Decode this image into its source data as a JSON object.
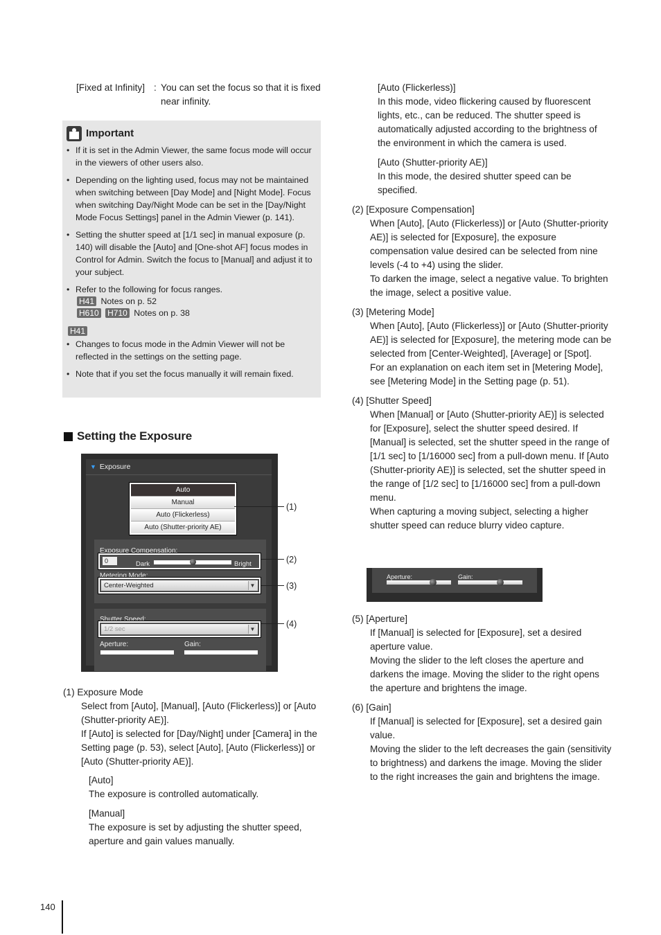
{
  "definition": {
    "term": "[Fixed at Infinity]",
    "colon": ":",
    "desc": "You can set the focus so that it is fixed near infinity."
  },
  "important": {
    "icon": "important-book-icon",
    "title": "Important",
    "items": [
      "If it is set in the Admin Viewer, the same focus mode will occur in the viewers of other users also.",
      "Depending on the lighting used, focus may not be maintained when switching between [Day Mode] and [Night Mode]. Focus when switching Day/Night Mode can be set in the [Day/Night Mode Focus Settings] panel in the Admin Viewer (p. 141).",
      "Setting the shutter speed at [1/1 sec] in manual exposure (p. 140) will disable the [Auto] and [One-shot AF] focus modes in Control for Admin. Switch the focus to [Manual] and adjust it to your subject.",
      "Refer to the following for focus ranges."
    ],
    "ranges": [
      {
        "badges": [
          "H41"
        ],
        "text": "Notes on p. 52"
      },
      {
        "badges": [
          "H610",
          "H710"
        ],
        "text": "Notes on p. 38"
      }
    ],
    "model_badge": "H41",
    "model_items": [
      "Changes to focus mode in the Admin Viewer will not be reflected in the settings on the setting page.",
      "Note that if you set the focus manually it will remain fixed."
    ]
  },
  "section": {
    "title": "Setting the Exposure"
  },
  "panel": {
    "header": "Exposure",
    "modes": [
      "Auto",
      "Manual",
      "Auto (Flickerless)",
      "Auto (Shutter-priority AE)"
    ],
    "selected_mode": "Auto",
    "exposure_comp_label": "Exposure Compensation:",
    "exposure_comp_value": "0",
    "exposure_comp_min_label": "Dark",
    "exposure_comp_max_label": "Bright",
    "exposure_comp_fraction": 0.5,
    "metering_label": "Metering Mode:",
    "metering_value": "Center-Weighted",
    "shutter_label": "Shutter Speed:",
    "shutter_value": "1/2 sec",
    "aperture_label": "Aperture:",
    "gain_label": "Gain:",
    "callouts": [
      "(1)",
      "(2)",
      "(3)",
      "(4)"
    ]
  },
  "left_body": {
    "item1_head": "(1)  Exposure Mode",
    "item1_text": "Select from [Auto], [Manual], [Auto (Flickerless)] or [Auto (Shutter-priority AE)].",
    "item1_text2": "If [Auto] is selected for [Day/Night] under [Camera] in the Setting page (p. 53), select [Auto], [Auto (Flickerless)] or [Auto (Shutter-priority AE)].",
    "auto_head": "[Auto]",
    "auto_text": "The exposure is controlled automatically.",
    "manual_head": "[Manual]",
    "manual_text": "The exposure is set by adjusting the shutter speed, aperture and gain values manually."
  },
  "right_body": {
    "flicker_head": "[Auto (Flickerless)]",
    "flicker_text": "In this mode, video flickering caused by fluorescent lights, etc., can be reduced. The shutter speed is automatically adjusted according to the brightness of the environment in which the camera is used.",
    "shutter_ae_head": "[Auto (Shutter-priority AE)]",
    "shutter_ae_text": "In this mode, the desired shutter speed can be specified.",
    "item2_head": "(2)  [Exposure Compensation]",
    "item2_text": "When [Auto], [Auto (Flickerless)] or [Auto (Shutter-priority AE)] is selected for [Exposure], the exposure compensation value desired can be selected from nine levels (-4 to +4) using the slider.",
    "item2_text2": "To darken the image, select a negative value. To brighten the image, select a positive value.",
    "item3_head": "(3)  [Metering Mode]",
    "item3_text": "When [Auto], [Auto (Flickerless)] or [Auto (Shutter-priority AE)] is selected for [Exposure], the metering mode can be selected from [Center-Weighted], [Average] or [Spot].",
    "item3_text2": "For an explanation on each item set in [Metering Mode], see [Metering Mode] in the Setting page (p. 51).",
    "item4_head": "(4)  [Shutter Speed]",
    "item4_text": "When [Manual] or [Auto (Shutter-priority AE)] is selected for [Exposure], select the shutter speed desired. If [Manual] is selected, set the shutter speed in the range of [1/1 sec] to [1/16000 sec] from a pull-down menu. If [Auto (Shutter-priority AE)] is selected, set the shutter speed in the range of [1/2 sec] to [1/16000 sec] from a pull-down menu.",
    "item4_text2": "When capturing a moving subject, selecting a higher shutter speed can reduce blurry video capture.",
    "mini": {
      "aperture_label": "Aperture:",
      "gain_label": "Gain:",
      "aperture_fraction": 0.75,
      "gain_fraction": 0.68
    },
    "item5_head": "(5)  [Aperture]",
    "item5_text": "If [Manual] is selected for [Exposure], set a desired aperture value.",
    "item5_text2": "Moving the slider to the left closes the aperture and darkens the image. Moving the slider to the right opens the aperture and brightens the image.",
    "item6_head": "(6)  [Gain]",
    "item6_text": "If [Manual] is selected for [Exposure], set a desired gain value.",
    "item6_text2": "Moving the slider to the left decreases the gain (sensitivity to brightness) and darkens the image. Moving the slider to the right increases the gain and brightens the image."
  },
  "footer": {
    "page_number": "140"
  }
}
